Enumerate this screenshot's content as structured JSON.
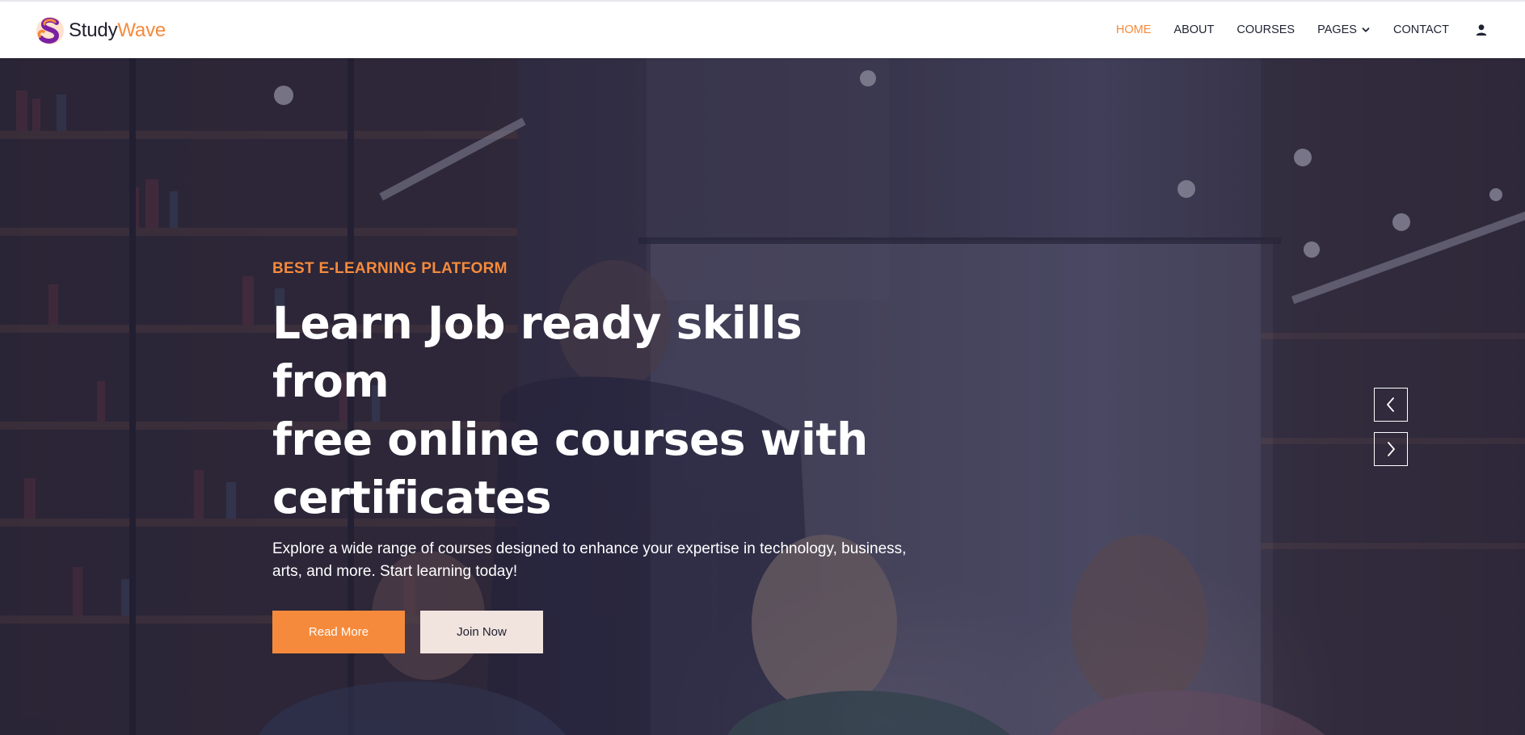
{
  "brand": {
    "name_part1": "Study",
    "name_part2": "Wave",
    "logo_icon": "studywave-s-logo-icon",
    "colors": {
      "accent": "#f68a3c",
      "logo_purple": "#7a1fa2",
      "text_dark": "#1f1f2e"
    }
  },
  "nav": {
    "items": [
      {
        "label": "HOME",
        "active": true
      },
      {
        "label": "ABOUT",
        "active": false
      },
      {
        "label": "COURSES",
        "active": false
      },
      {
        "label": "PAGES",
        "active": false,
        "icon": "chevron-down-icon"
      },
      {
        "label": "CONTACT",
        "active": false
      }
    ],
    "user_icon": "user-icon"
  },
  "hero": {
    "eyebrow": "BEST E-LEARNING PLATFORM",
    "headline_lines": [
      "Learn Job ready skills from",
      "free online courses with",
      "certificates"
    ],
    "subtext": "Explore a wide range of courses designed to enhance your expertise in technology, business, arts, and more. Start learning today!",
    "primary_button": "Read More",
    "secondary_button": "Join Now",
    "prev_icon": "chevron-left-icon",
    "next_icon": "chevron-right-icon",
    "background": "students-in-library-photo"
  }
}
